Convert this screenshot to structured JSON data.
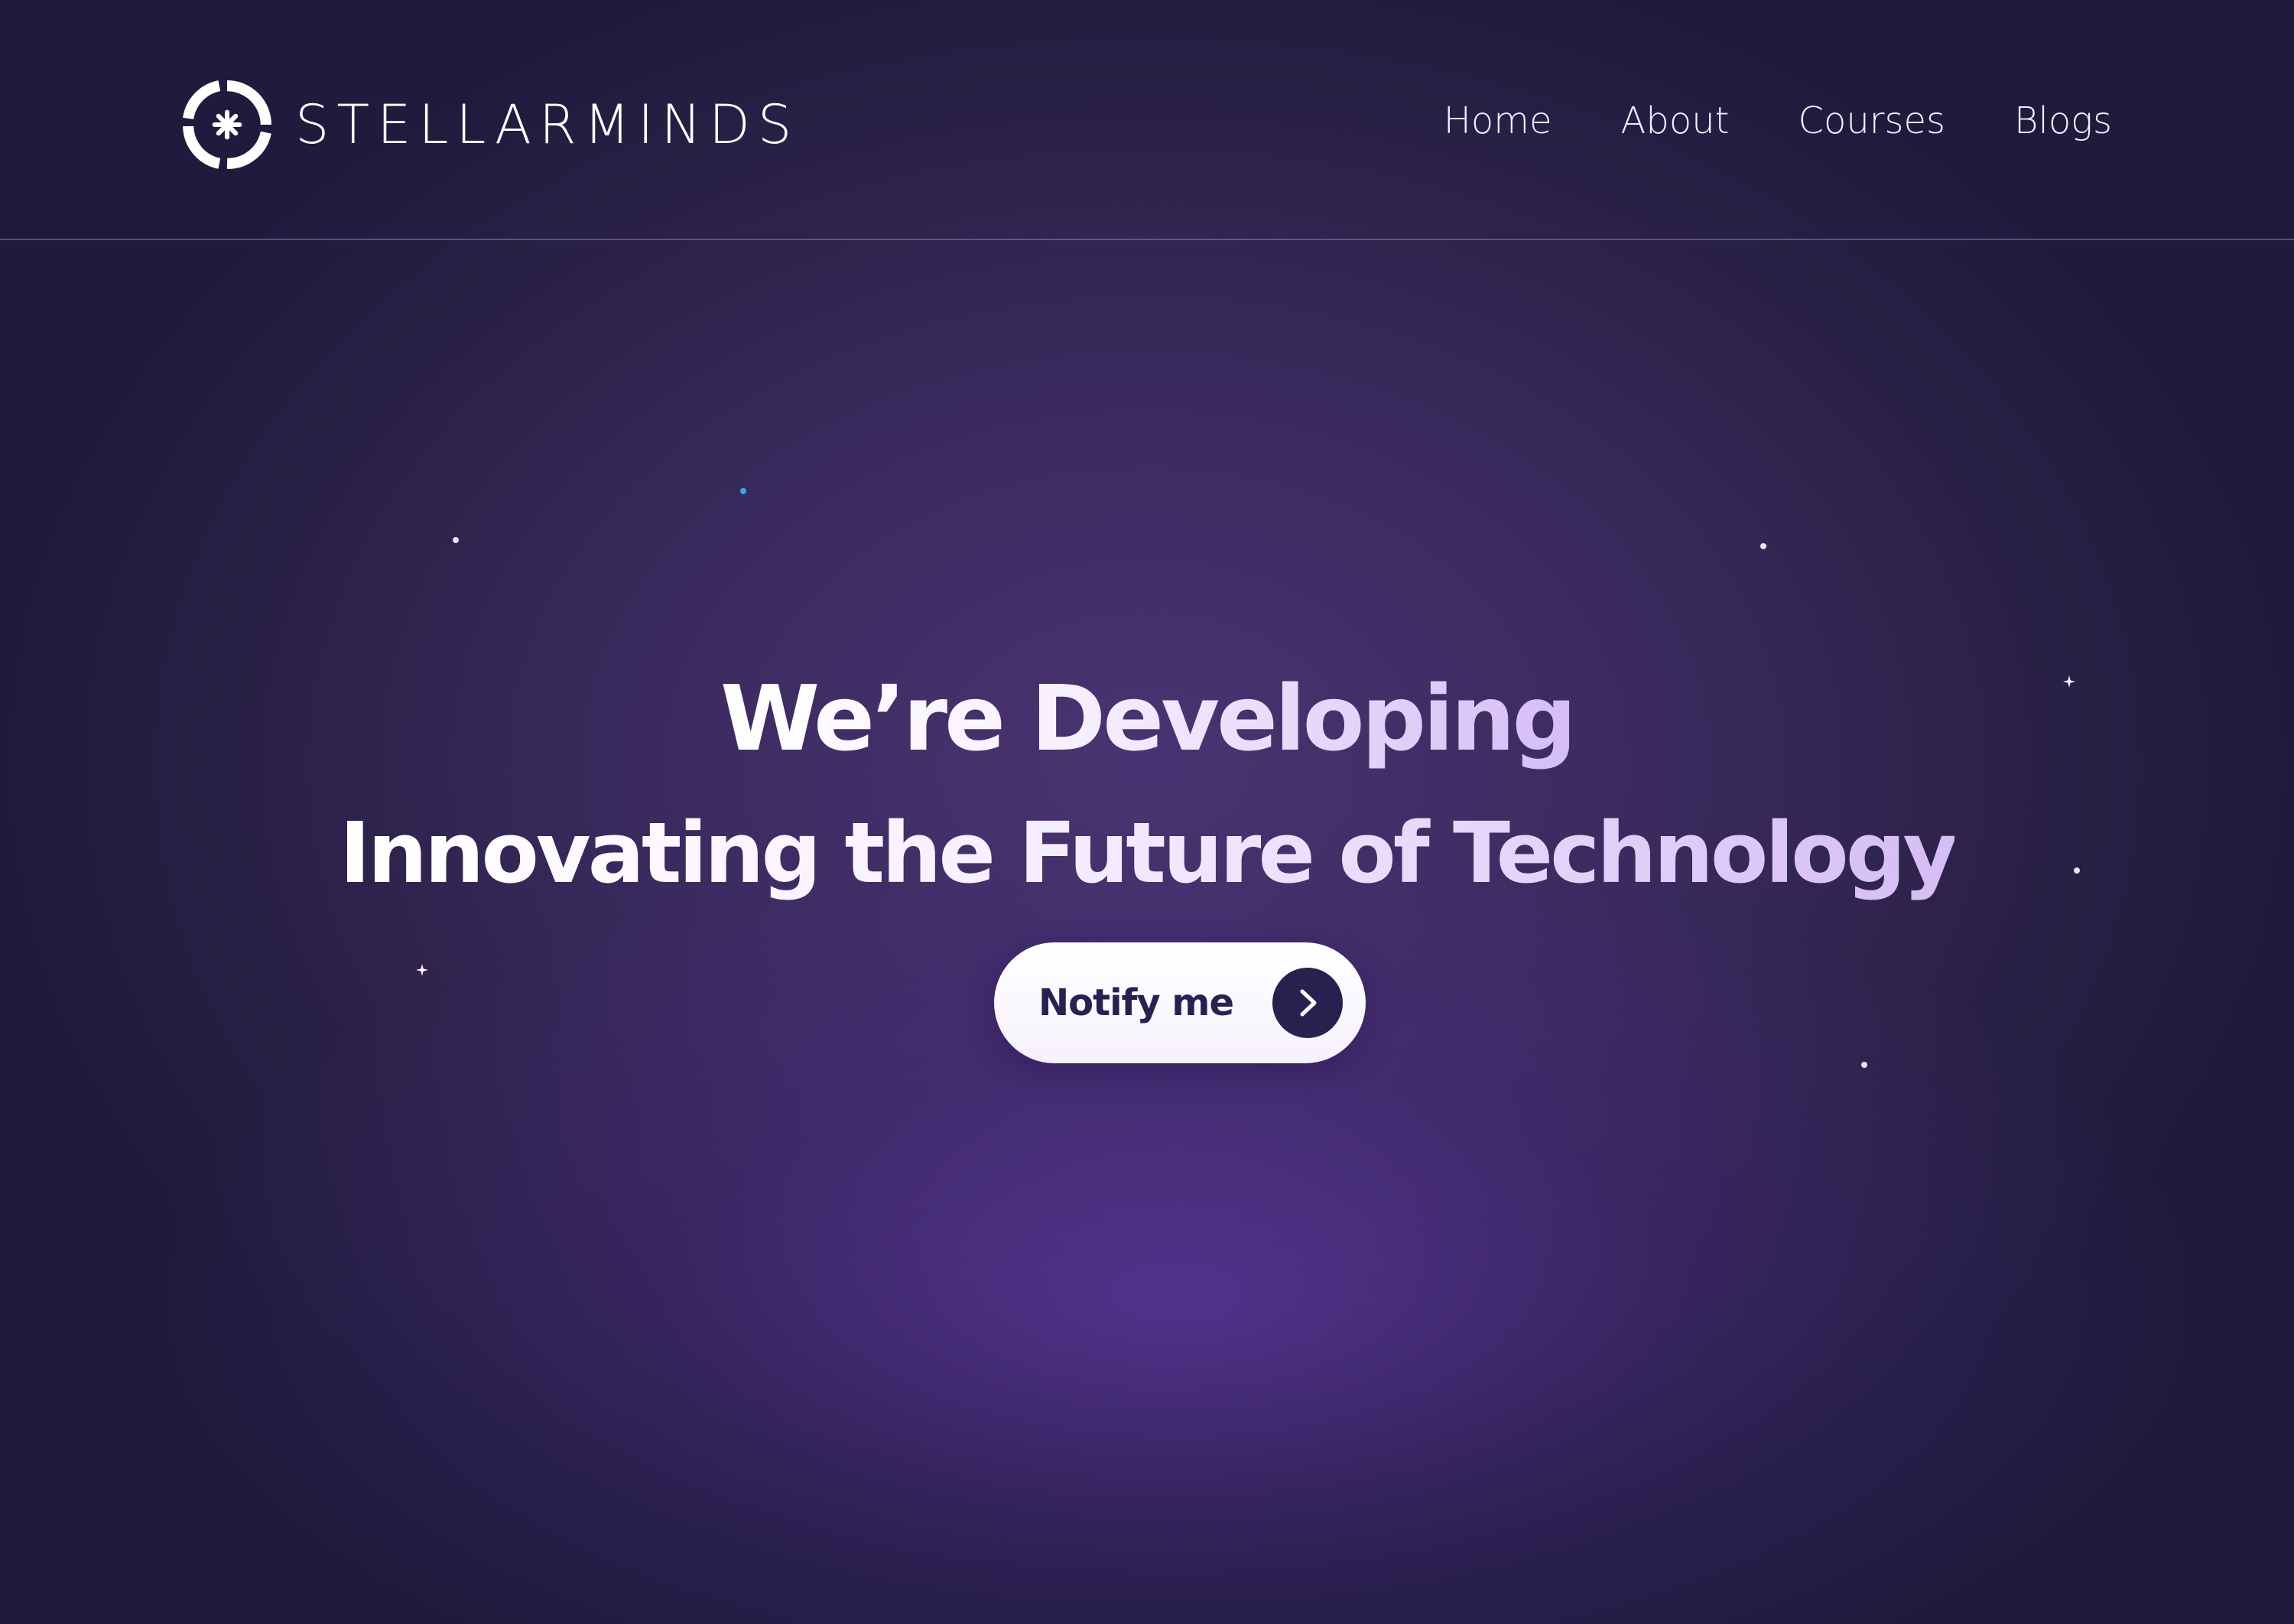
{
  "brand": {
    "name": "STELLARMINDS",
    "logo_icon": "stellarminds-logo-icon"
  },
  "nav": {
    "items": [
      {
        "label": "Home"
      },
      {
        "label": "About"
      },
      {
        "label": "Courses"
      },
      {
        "label": "Blogs"
      }
    ]
  },
  "hero": {
    "line1": "We’re Developing",
    "line2": "Innovating the Future of Technology"
  },
  "cta": {
    "label": "Notify me",
    "icon": "chevron-right-icon"
  },
  "colors": {
    "bg_dark": "#1f1b3d",
    "bg_mid": "#3a2a5e",
    "glow": "#6e3cbe",
    "button_bg": "#ffffff",
    "button_text": "#2a2050",
    "accent_star": "#3aa8e8"
  }
}
